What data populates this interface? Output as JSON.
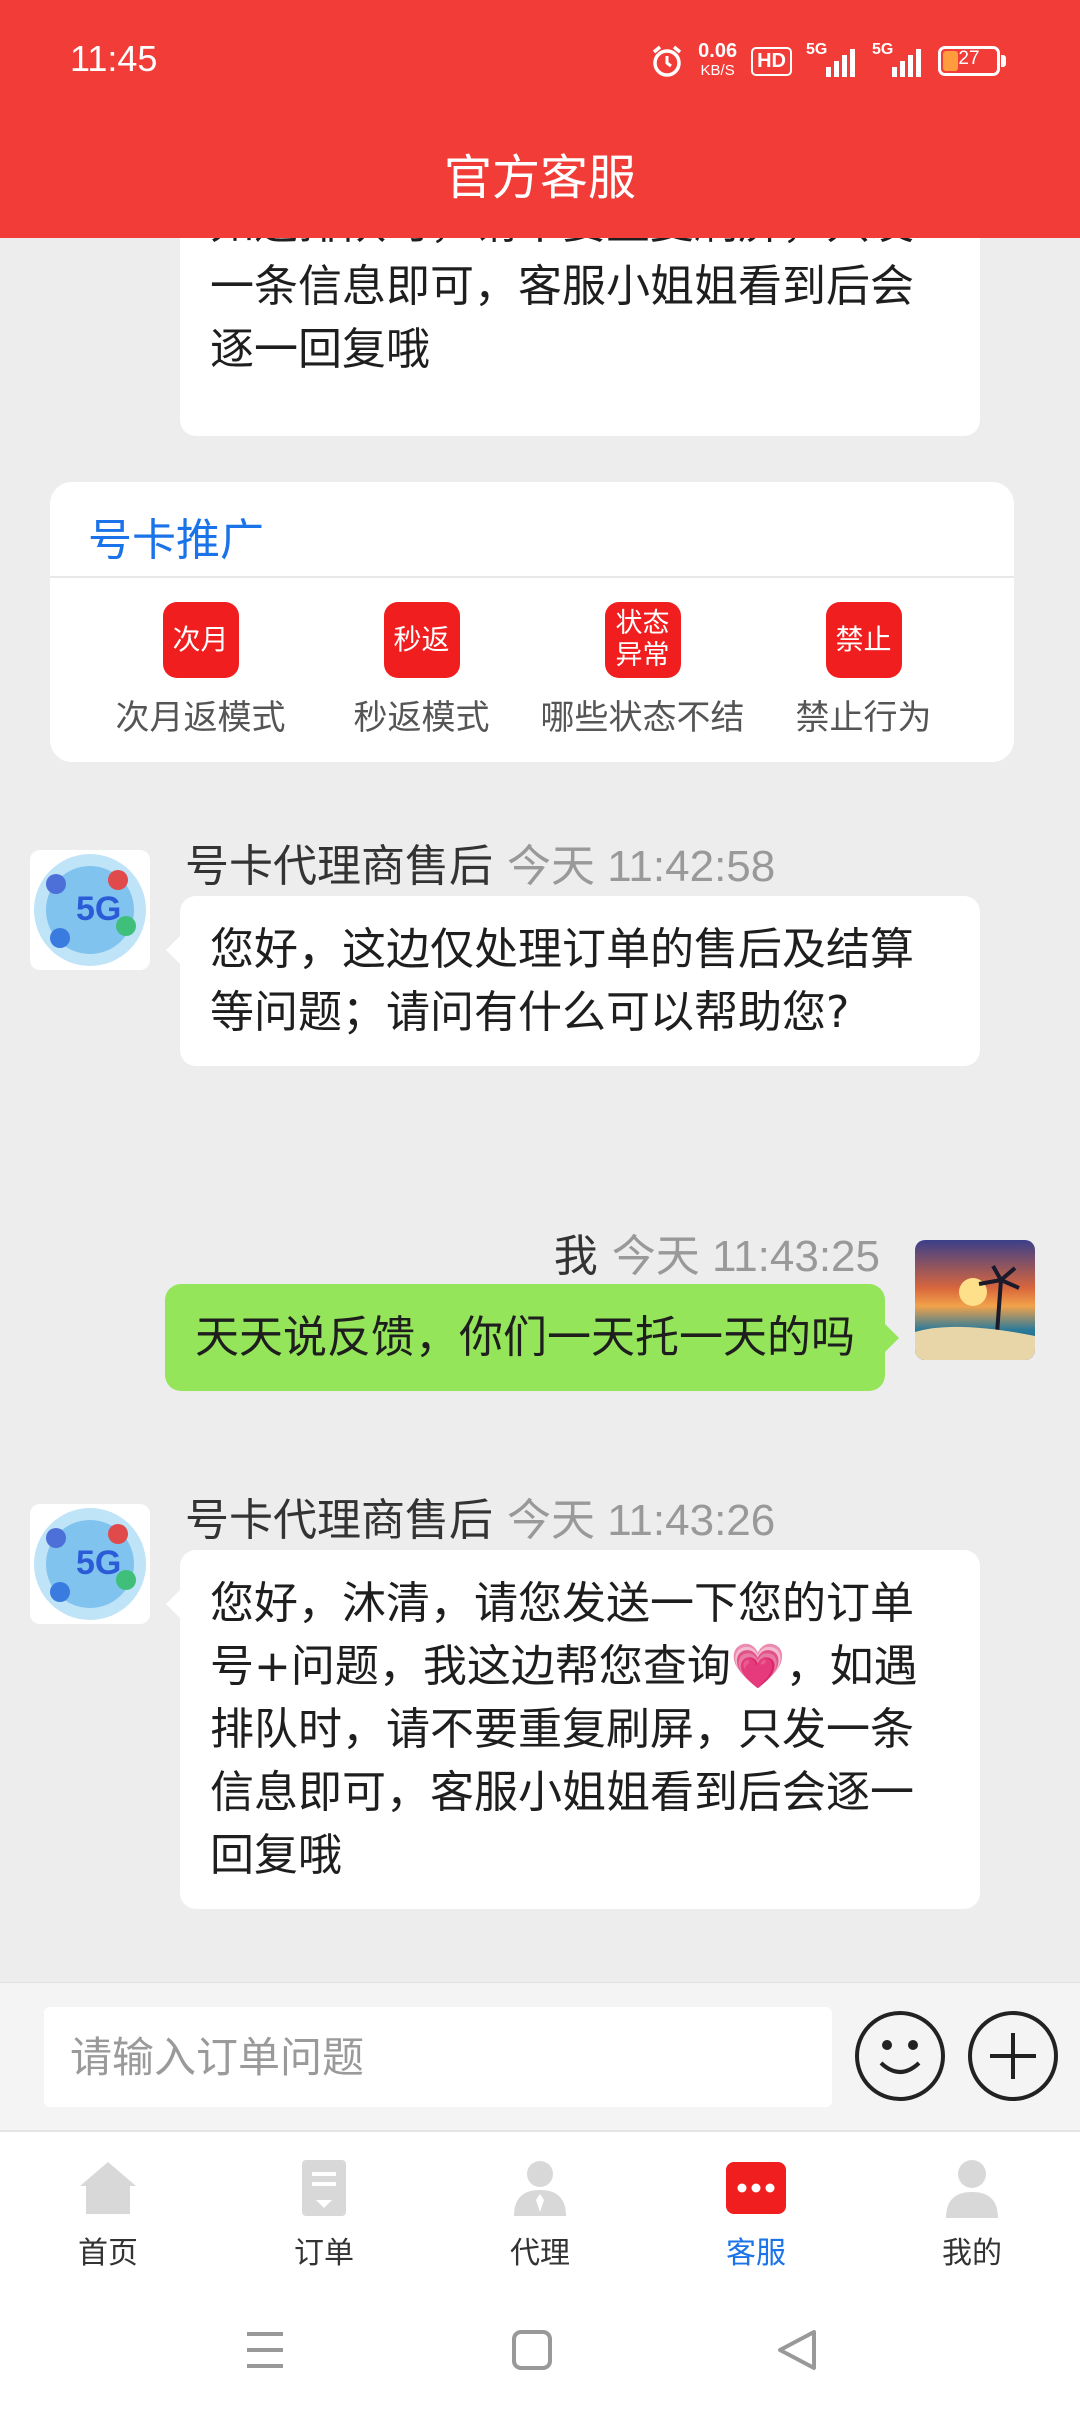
{
  "status_bar": {
    "time": "11:45",
    "net_speed": "0.06",
    "net_unit": "KB/S",
    "hd_badge": "HD",
    "signal1": "5G",
    "signal2": "5G",
    "battery": "27",
    "battery_level": 0.27
  },
  "header": {
    "title": "官方客服"
  },
  "chat": {
    "first_fragment": "如遇排队时，请不要重复刷屏，只发一条信息即可，客服小姐姐看到后会逐一回复哦",
    "promo": {
      "title": "号卡推广",
      "items": [
        {
          "badge": "次月",
          "label": "次月返模式"
        },
        {
          "badge": "秒返",
          "label": "秒返模式"
        },
        {
          "badge": "状态异常",
          "label": "哪些状态不结"
        },
        {
          "badge": "禁止",
          "label": "禁止行为"
        }
      ]
    },
    "messages": [
      {
        "sender": "号卡代理商售后",
        "time": "今天 11:42:58",
        "text": "您好，这边仅处理订单的售后及结算等问题；请问有什么可以帮助您?"
      },
      {
        "sender": "我",
        "time": "今天 11:43:25",
        "text": "天天说反馈，你们一天托一天的吗"
      },
      {
        "sender": "号卡代理商售后",
        "time": "今天 11:43:26",
        "text": "您好，沐清，请您发送一下您的订单号+问题，我这边帮您查询💗，如遇排队时，请不要重复刷屏，只发一条信息即可，客服小姐姐看到后会逐一回复哦"
      }
    ]
  },
  "input": {
    "placeholder": "请输入订单问题"
  },
  "tabs": [
    {
      "label": "首页",
      "icon": "home-icon"
    },
    {
      "label": "订单",
      "icon": "order-icon"
    },
    {
      "label": "代理",
      "icon": "agent-icon"
    },
    {
      "label": "客服",
      "icon": "service-icon"
    },
    {
      "label": "我的",
      "icon": "profile-icon"
    }
  ],
  "active_tab": "客服",
  "colors": {
    "header": "#f23c38",
    "accent_blue": "#1a73e8",
    "out_bubble": "#95e55a",
    "badge_red": "#f01e1e"
  }
}
